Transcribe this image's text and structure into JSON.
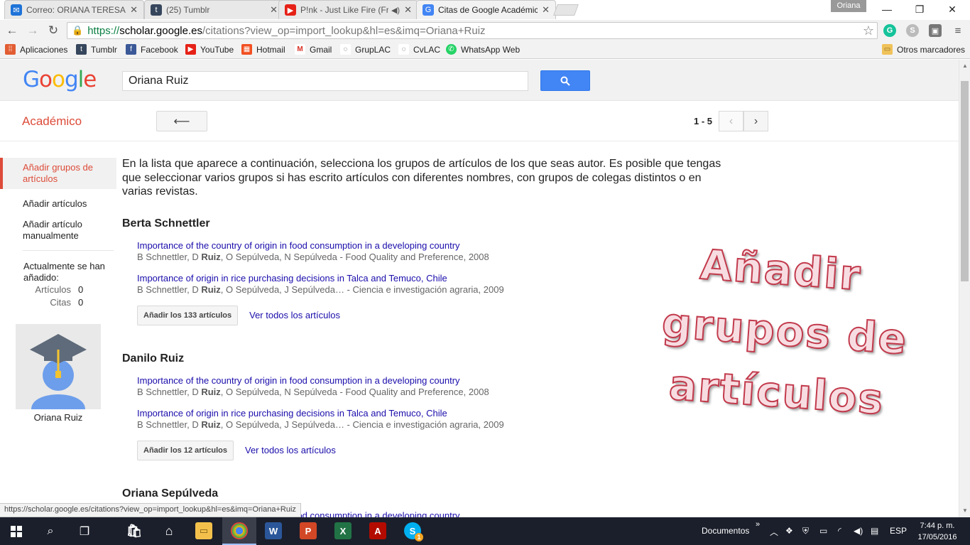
{
  "browser": {
    "tabs": [
      {
        "title": "Correo: ORIANA TERESA R",
        "icon": "mail-icon",
        "color": "#1e73d8"
      },
      {
        "title": "(25) Tumblr",
        "icon": "tumblr-icon",
        "color": "#36465d"
      },
      {
        "title": "P!nk - Just Like Fire (Fro",
        "icon": "youtube-icon",
        "color": "#e62117"
      },
      {
        "title": "Citas de Google Académic",
        "icon": "scholar-icon",
        "color": "#4285f4"
      }
    ],
    "profile_name": "Oriana",
    "url_scheme": "https://",
    "url_host": "scholar.google.es",
    "url_path": "/citations?view_op=import_lookup&hl=es&imq=Oriana+Ruiz",
    "bookmarks": [
      {
        "label": "Aplicaciones",
        "icon": "apps-icon"
      },
      {
        "label": "Tumblr",
        "icon": "tumblr-icon"
      },
      {
        "label": "Facebook",
        "icon": "facebook-icon"
      },
      {
        "label": "YouTube",
        "icon": "youtube-icon"
      },
      {
        "label": "Hotmail",
        "icon": "hotmail-icon"
      },
      {
        "label": "Gmail",
        "icon": "gmail-icon"
      },
      {
        "label": "GrupLAC",
        "icon": "gruplac-icon"
      },
      {
        "label": "CvLAC",
        "icon": "cvlac-icon"
      },
      {
        "label": "WhatsApp Web",
        "icon": "whatsapp-icon"
      }
    ],
    "other_bookmarks": "Otros marcadores",
    "status_url": "https://scholar.google.es/citations?view_op=import_lookup&hl=es&imq=Oriana+Ruiz"
  },
  "scholar": {
    "logo": "Google",
    "search_value": "Oriana Ruiz",
    "section_title": "Académico",
    "pager": "1 - 5",
    "sidebar": {
      "items": [
        {
          "label": "Añadir grupos de artículos"
        },
        {
          "label": "Añadir artículos"
        },
        {
          "label": "Añadir artículo manualmente"
        }
      ],
      "added_title": "Actualmente se han añadido:",
      "articles_label": "Artículos",
      "articles_count": "0",
      "citations_label": "Citas",
      "citations_count": "0",
      "owner_name": "Oriana Ruiz"
    },
    "intro": "En la lista que aparece a continuación, selecciona los grupos de artículos de los que seas autor. Es posible que tengas que seleccionar varios grupos si has escrito artículos con diferentes nombres, con grupos de colegas distintos o en varias revistas.",
    "groups": [
      {
        "name": "Berta Schnettler",
        "articles": [
          {
            "title": "Importance of the country of origin in food consumption in a developing country",
            "authors_pre": "B Schnettler, D ",
            "authors_bold": "Ruiz",
            "authors_post": ", O Sepúlveda, N Sepúlveda - Food Quality and Preference, 2008"
          },
          {
            "title": "Importance of origin in rice purchasing decisions in Talca and Temuco, Chile",
            "authors_pre": "B Schnettler, D ",
            "authors_bold": "Ruiz",
            "authors_post": ", O Sepúlveda, J Sepúlveda… - Ciencia e investigación agraria, 2009"
          }
        ],
        "add_label": "Añadir los 133 artículos",
        "see_all": "Ver todos los artículos"
      },
      {
        "name": "Danilo Ruiz",
        "articles": [
          {
            "title": "Importance of the country of origin in food consumption in a developing country",
            "authors_pre": "B Schnettler, D ",
            "authors_bold": "Ruiz",
            "authors_post": ", O Sepúlveda, N Sepúlveda - Food Quality and Preference, 2008"
          },
          {
            "title": "Importance of origin in rice purchasing decisions in Talca and Temuco, Chile",
            "authors_pre": "B Schnettler, D ",
            "authors_bold": "Ruiz",
            "authors_post": ", O Sepúlveda, J Sepúlveda… - Ciencia e investigación agraria, 2009"
          }
        ],
        "add_label": "Añadir los 12 artículos",
        "see_all": "Ver todos los artículos"
      },
      {
        "name": "Oriana Sepúlveda",
        "articles": [
          {
            "title": "Importance of the country of origin in food consumption in a developing country",
            "authors_pre": "",
            "authors_bold": "",
            "authors_post": ""
          }
        ]
      }
    ],
    "wordart": [
      "Añadir",
      "grupos de",
      "artículos"
    ]
  },
  "taskbar": {
    "documents_label": "Documentos",
    "language": "ESP",
    "time": "7:44 p. m.",
    "date": "17/05/2016",
    "skype_badge": "1"
  },
  "colors": {
    "accent_red": "#dd4b39",
    "link_blue": "#1a0dab",
    "search_blue": "#4285f4",
    "taskbar": "#1b1f2b"
  }
}
